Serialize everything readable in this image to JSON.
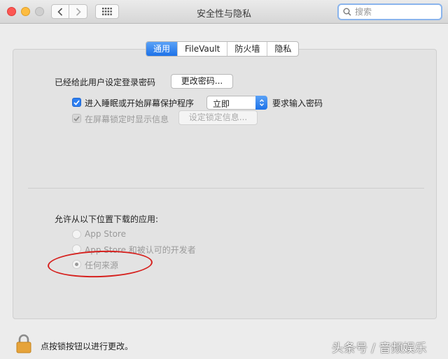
{
  "window": {
    "title": "安全性与隐私"
  },
  "search": {
    "placeholder": "搜索"
  },
  "tabs": [
    {
      "label": "通用",
      "active": true
    },
    {
      "label": "FileVault",
      "active": false
    },
    {
      "label": "防火墙",
      "active": false
    },
    {
      "label": "隐私",
      "active": false
    }
  ],
  "general": {
    "password_set_label": "已经给此用户设定登录密码",
    "change_password_button": "更改密码...",
    "require_password_label": "进入睡眠或开始屏幕保护程序",
    "require_password_checked": true,
    "require_delay_value": "立即",
    "require_password_suffix": "要求输入密码",
    "show_message_label": "在屏幕锁定时显示信息",
    "show_message_checked": true,
    "set_lock_message_button": "设定锁定信息..."
  },
  "downloads": {
    "heading": "允许从以下位置下载的应用:",
    "options": [
      {
        "label": "App Store",
        "selected": false
      },
      {
        "label": "App Store 和被认可的开发者",
        "selected": false
      },
      {
        "label": "任何来源",
        "selected": true
      }
    ]
  },
  "footer": {
    "lock_text": "点按锁按钮以进行更改。"
  },
  "watermark": "头条号 / 音频娱乐",
  "colors": {
    "accent": "#1d72e8",
    "annotation": "#d6211e",
    "lock": "#e6a33a"
  }
}
